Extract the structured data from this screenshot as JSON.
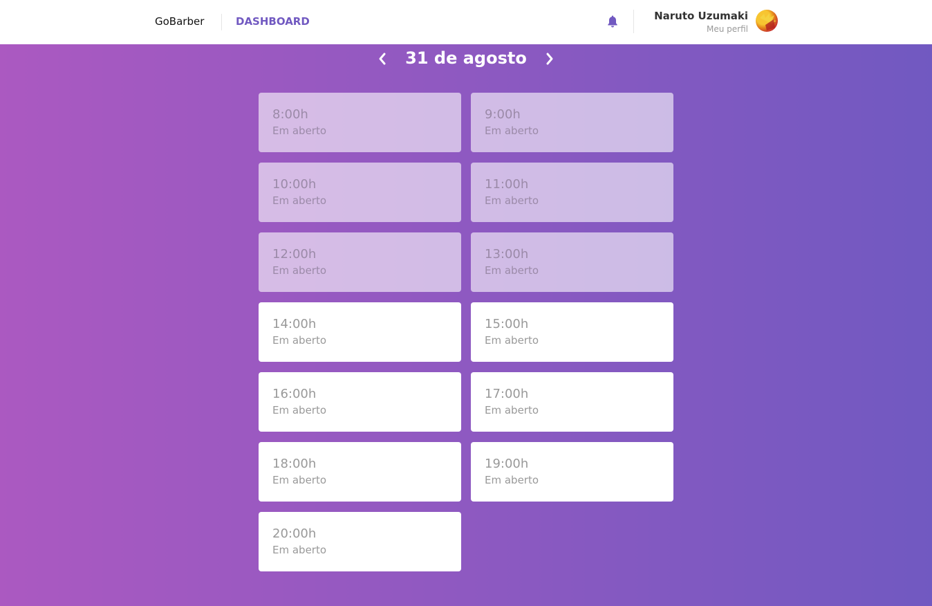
{
  "header": {
    "brand": "GoBarber",
    "nav_label": "DASHBOARD",
    "profile_name": "Naruto Uzumaki",
    "profile_link": "Meu perfil"
  },
  "date_nav": {
    "title": "31 de agosto",
    "prev_icon": "chevron-left-icon",
    "next_icon": "chevron-right-icon"
  },
  "colors": {
    "accent": "#7159c1",
    "gradient_start": "#ab59c1",
    "gradient_end": "#7159c1"
  },
  "slots": [
    {
      "time": "8:00h",
      "status": "Em aberto",
      "past": true
    },
    {
      "time": "9:00h",
      "status": "Em aberto",
      "past": true
    },
    {
      "time": "10:00h",
      "status": "Em aberto",
      "past": true
    },
    {
      "time": "11:00h",
      "status": "Em aberto",
      "past": true
    },
    {
      "time": "12:00h",
      "status": "Em aberto",
      "past": true
    },
    {
      "time": "13:00h",
      "status": "Em aberto",
      "past": true
    },
    {
      "time": "14:00h",
      "status": "Em aberto",
      "past": false
    },
    {
      "time": "15:00h",
      "status": "Em aberto",
      "past": false
    },
    {
      "time": "16:00h",
      "status": "Em aberto",
      "past": false
    },
    {
      "time": "17:00h",
      "status": "Em aberto",
      "past": false
    },
    {
      "time": "18:00h",
      "status": "Em aberto",
      "past": false
    },
    {
      "time": "19:00h",
      "status": "Em aberto",
      "past": false
    },
    {
      "time": "20:00h",
      "status": "Em aberto",
      "past": false
    }
  ]
}
